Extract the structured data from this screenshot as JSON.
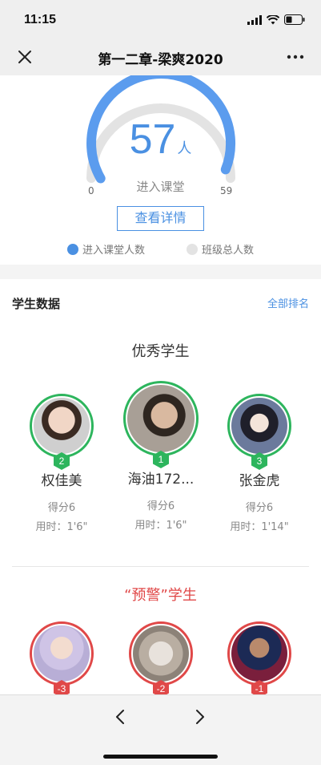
{
  "status": {
    "time": "11:15"
  },
  "nav": {
    "title": "第一二章-梁爽2020",
    "close_icon": "close-icon",
    "more_icon": "more-icon"
  },
  "gauge": {
    "value": "57",
    "unit": "人",
    "caption": "进入课堂",
    "min": "0",
    "max": "59",
    "fill_fraction": 0.966,
    "detail_label": "查看详情",
    "legend": [
      {
        "label": "进入课堂人数",
        "color": "#4a90e2"
      },
      {
        "label": "班级总人数",
        "color": "#e3e3e3"
      }
    ]
  },
  "students": {
    "section_title": "学生数据",
    "rank_link": "全部排名",
    "excellent_title": "优秀学生",
    "excellent": [
      {
        "rank": "2",
        "name": "权佳美",
        "score": "得分6",
        "time": "用时：1'6\""
      },
      {
        "rank": "1",
        "name": "海油172...",
        "score": "得分6",
        "time": "用时：1'6\""
      },
      {
        "rank": "3",
        "name": "张金虎",
        "score": "得分6",
        "time": "用时：1'14\""
      }
    ],
    "warning_title": "“预警”学生",
    "warning": [
      {
        "rank": "-3"
      },
      {
        "rank": "-2"
      },
      {
        "rank": "-1"
      }
    ]
  },
  "colors": {
    "accent": "#4a90e2",
    "excellent": "#2db55d",
    "warning": "#e04848"
  }
}
